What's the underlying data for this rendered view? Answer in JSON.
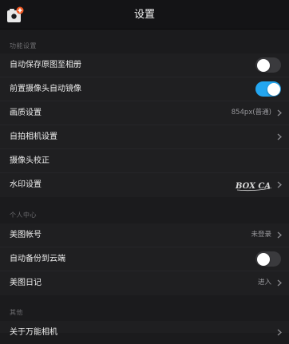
{
  "header": {
    "title": "设置"
  },
  "sections": {
    "function": {
      "title": "功能设置",
      "auto_save": {
        "label": "自动保存原图至相册",
        "toggle_on": false
      },
      "mirror": {
        "label": "前置摄像头自动镜像",
        "toggle_on": true
      },
      "quality": {
        "label": "画质设置",
        "value": "854px(普通)"
      },
      "selfie": {
        "label": "自拍相机设置"
      },
      "calibrate": {
        "label": "摄像头校正"
      },
      "watermark": {
        "label": "水印设置",
        "logo_text": "BOX CAM"
      }
    },
    "personal": {
      "title": "个人中心",
      "account": {
        "label": "美图帐号",
        "value": "未登录"
      },
      "backup": {
        "label": "自动备份到云端",
        "toggle_on": false
      },
      "diary": {
        "label": "美图日记",
        "value": "进入"
      }
    },
    "other": {
      "title": "其他",
      "about": {
        "label": "关于万能相机"
      }
    }
  },
  "colors": {
    "toggle_on": "#23a6f0",
    "toggle_off": "#3a3a3d",
    "app_icon_accent": "#f25a24"
  }
}
